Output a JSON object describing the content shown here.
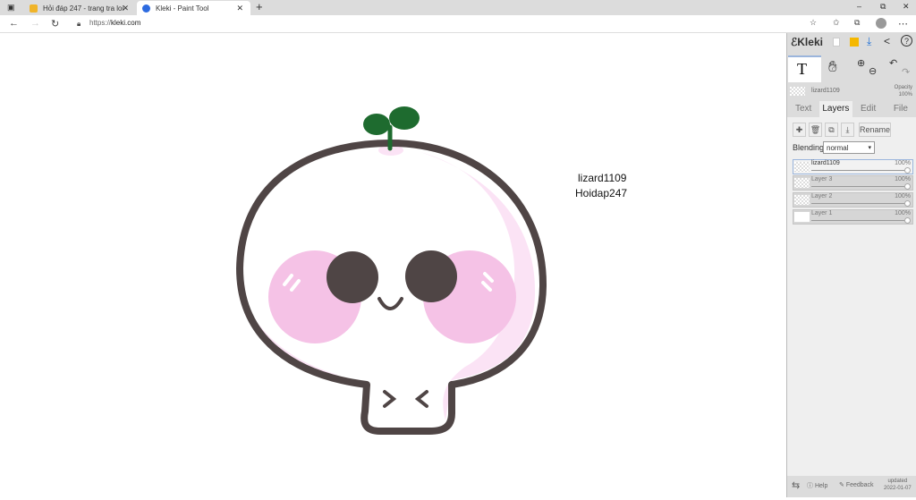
{
  "browser": {
    "tabs": [
      {
        "title": "Hỏi đáp 247 - trang tra loi",
        "active": false
      },
      {
        "title": "Kleki - Paint Tool",
        "active": true
      }
    ],
    "new_tab": "+",
    "url_prefix": "https://",
    "url_host": "kleki.com",
    "window": {
      "minimize": "–",
      "maximize": "⧉",
      "close": "✕"
    }
  },
  "canvas": {
    "signature": [
      "lizard1109",
      "Hoidap247"
    ],
    "colors": {
      "outline": "#4f4545",
      "cheek": "#f5c2e6",
      "sprout": "#1e6b2f",
      "shade": "#fbe3f5"
    }
  },
  "panel": {
    "logo": "Kleki",
    "current_layer": "lizard1109",
    "opacity_label": "Opacity",
    "opacity_value": "100%",
    "tabs": [
      {
        "label": "Text",
        "active": false
      },
      {
        "label": "Layers",
        "active": true
      },
      {
        "label": "Edit",
        "active": false
      },
      {
        "label": "File",
        "active": false
      }
    ],
    "rename": "Rename",
    "blending_label": "Blending",
    "blending_value": "normal",
    "layers": [
      {
        "name": "lizard1109",
        "opacity": "100%",
        "selected": true
      },
      {
        "name": "Layer 3",
        "opacity": "100%"
      },
      {
        "name": "Layer 2",
        "opacity": "100%"
      },
      {
        "name": "Layer 1",
        "opacity": "100%"
      }
    ],
    "footer": {
      "help": "Help",
      "feedback": "Feedback",
      "updated": "updated",
      "date": "2022-01-07"
    }
  }
}
